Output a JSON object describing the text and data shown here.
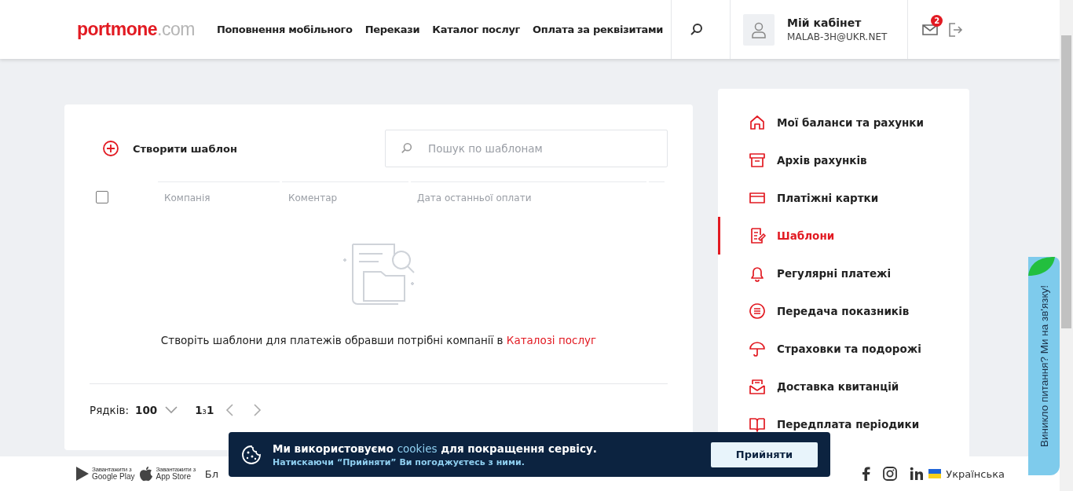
{
  "header": {
    "logo": {
      "main": "portmone",
      "suffix": ".com"
    },
    "nav": [
      "Поповнення мобільного",
      "Перекази",
      "Каталог послуг",
      "Оплата за реквізитами"
    ],
    "account": {
      "title": "Мій кабінет",
      "email": "MALAB-3H@UKR.NET"
    },
    "mail_badge": "2"
  },
  "templates": {
    "create_label": "Створити шаблон",
    "search": {
      "placeholder": "Пошук по шаблонам"
    },
    "select_all": {
      "checked": false
    },
    "columns": [
      "Компанія",
      "Коментар",
      "Дата останньої оплати"
    ],
    "empty_text": "Створіть шаблони для платежів обравши потрібні компанії в",
    "empty_link": "Каталозі послуг",
    "pagination": {
      "rows_label": "Рядків:",
      "rows_value": "100",
      "page": "1",
      "of": "з",
      "total": "1"
    }
  },
  "sidebar": {
    "items": [
      {
        "label": "Мої баланси та рахунки",
        "selected": false
      },
      {
        "label": "Архів рахунків",
        "selected": false
      },
      {
        "label": "Платіжні картки",
        "selected": false
      },
      {
        "label": "Шаблони",
        "selected": true
      },
      {
        "label": "Регулярні платежі",
        "selected": false
      },
      {
        "label": "Передача показників",
        "selected": false
      },
      {
        "label": "Страховки та подорожі",
        "selected": false
      },
      {
        "label": "Доставка квитанцій",
        "selected": false
      },
      {
        "label": "Передплата періодики",
        "selected": false
      }
    ]
  },
  "footer": {
    "apps": [
      {
        "small": "Завантажити з",
        "name": "Google Play"
      },
      {
        "small": "Завантажити з",
        "name": "App Store"
      }
    ],
    "link_fragment": "Бл",
    "language": "Українська"
  },
  "cookie_banner": {
    "text_before": "Ми використовуємо",
    "link": "cookies",
    "text_after": "для покращення сервісу.",
    "note": "Натискаючи “Прийняти” Ви погоджуєтесь з ними.",
    "button": "Прийняти"
  },
  "feedback_tab": "Виникло питання? Ми на зв'язку!"
}
